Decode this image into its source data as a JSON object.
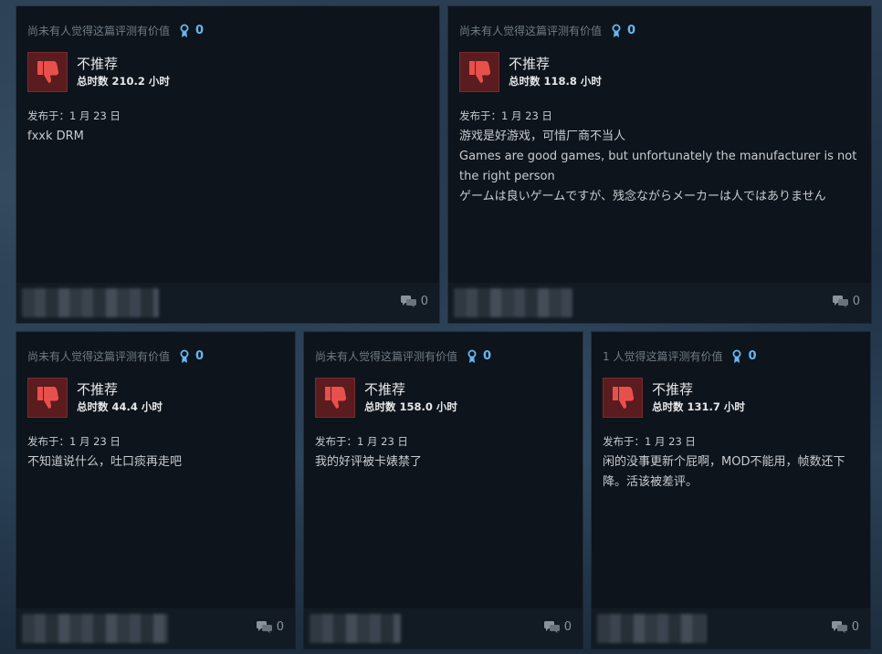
{
  "reviews": [
    {
      "helpful_text": "尚未有人觉得这篇评测有价值",
      "award_count": "0",
      "verdict": "不推荐",
      "hours": "总时数 210.2 小时",
      "posted": "发布于：1 月 23 日",
      "content_lines": [
        "fxxk DRM"
      ],
      "comment_count": "0"
    },
    {
      "helpful_text": "尚未有人觉得这篇评测有价值",
      "award_count": "0",
      "verdict": "不推荐",
      "hours": "总时数 118.8 小时",
      "posted": "发布于：1 月 23 日",
      "content_lines": [
        "游戏是好游戏，可惜厂商不当人",
        "Games are good games, but unfortunately the manufacturer is not the right person",
        "ゲームは良いゲームですが、残念ながらメーカーは人ではありません"
      ],
      "comment_count": "0"
    },
    {
      "helpful_text": "尚未有人觉得这篇评测有价值",
      "award_count": "0",
      "verdict": "不推荐",
      "hours": "总时数 44.4 小时",
      "posted": "发布于：1 月 23 日",
      "content_lines": [
        "不知道说什么，吐口痰再走吧"
      ],
      "comment_count": "0"
    },
    {
      "helpful_text": "尚未有人觉得这篇评测有价值",
      "award_count": "0",
      "verdict": "不推荐",
      "hours": "总时数 158.0 小时",
      "posted": "发布于：1 月 23 日",
      "content_lines": [
        "我的好评被卡婊禁了"
      ],
      "comment_count": "0"
    },
    {
      "helpful_text": "1 人觉得这篇评测有价值",
      "award_count": "0",
      "verdict": "不推荐",
      "hours": "总时数 131.7 小时",
      "posted": "发布于：1 月 23 日",
      "content_lines": [
        "闲的没事更新个屁啊，MOD不能用，帧数还下降。活该被差评。"
      ],
      "comment_count": "0"
    }
  ],
  "colors": {
    "card_bg": "#0e141b",
    "award_blue": "#66b7f2",
    "thumb_red": "#e8504c"
  },
  "icons": {
    "award": "award-ribbon-icon",
    "thumb": "thumbs-down-icon",
    "comment": "comment-bubble-icon"
  }
}
